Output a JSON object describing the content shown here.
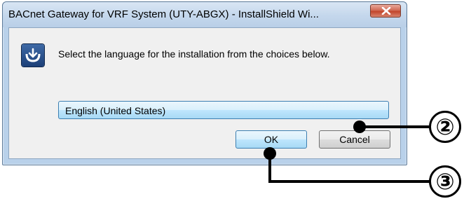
{
  "window": {
    "title": "BACnet Gateway for VRF System (UTY-ABGX) - InstallShield Wi...",
    "close_icon": "close-icon"
  },
  "dialog": {
    "app_icon": "installshield-icon",
    "prompt": "Select the language for the installation from the choices below.",
    "language_select": {
      "selected": "English (United States)"
    },
    "buttons": {
      "ok": "OK",
      "cancel": "Cancel"
    }
  },
  "callouts": [
    {
      "label": "②"
    },
    {
      "label": "③"
    }
  ]
}
